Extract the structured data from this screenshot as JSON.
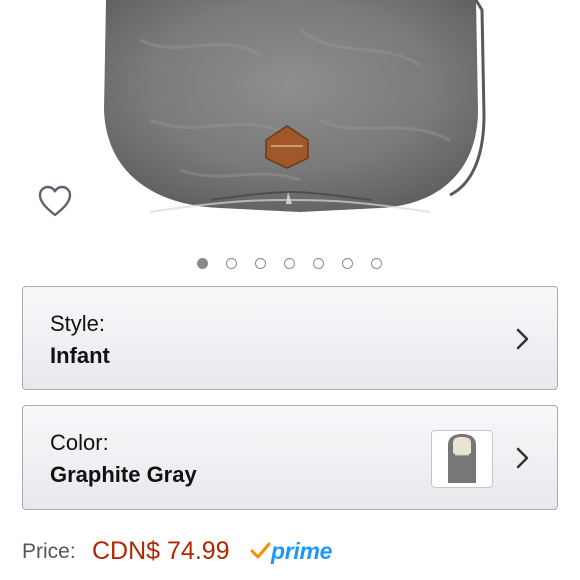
{
  "gallery": {
    "dot_count": 7,
    "active_index": 0
  },
  "variants": {
    "style": {
      "label": "Style:",
      "value": "Infant"
    },
    "color": {
      "label": "Color:",
      "value": "Graphite Gray"
    }
  },
  "price": {
    "label": "Price:",
    "value": "CDN$ 74.99",
    "prime_text": "prime"
  },
  "colors": {
    "price": "#b12704",
    "prime": "#1a98ff",
    "prime_check": "#f29100",
    "product": "#7d7d7d"
  },
  "icons": {
    "wishlist": "heart-outline-icon",
    "chevron": "chevron-right-icon",
    "prime_check": "checkmark-icon"
  }
}
